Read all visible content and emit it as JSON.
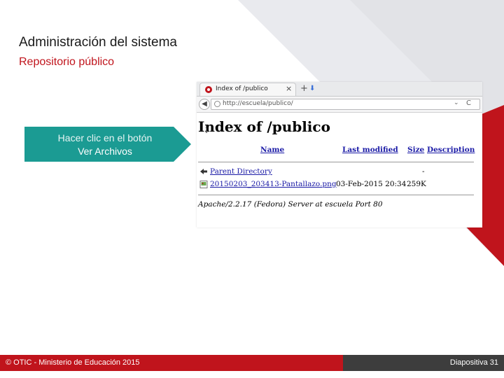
{
  "slide": {
    "title": "Administración del sistema",
    "subtitle": "Repositorio público"
  },
  "callout": {
    "line1": "Hacer clic en el botón",
    "line2": "Ver Archivos",
    "color": "#1b9b93"
  },
  "browser": {
    "tab_title": "Index of /publico",
    "tab_close": "×",
    "new_tab": "+",
    "download": "⬇",
    "back": "◀",
    "url": "http://escuela/publico/",
    "url_dropdown": "⌄",
    "reload": "C"
  },
  "listing": {
    "heading": "Index of /publico",
    "columns": [
      "Name",
      "Last modified",
      "Size",
      "Description"
    ],
    "rows": [
      {
        "icon": "back-arrow-icon",
        "name": "Parent Directory",
        "modified": "",
        "size": "-"
      },
      {
        "icon": "image-file-icon",
        "name": "20150203_203413-Pantallazo.png",
        "modified": "03-Feb-2015 20:34",
        "size": "259K"
      }
    ],
    "server": "Apache/2.2.17 (Fedora) Server at escuela Port 80"
  },
  "footer": {
    "copyright": "© OTIC - Ministerio de Educación 2015",
    "slide_number": "Diapositiva 31"
  },
  "colors": {
    "accent_red": "#c0141c",
    "teal": "#1b9b93",
    "dark": "#3d3d3d",
    "link": "#1a1aa6"
  }
}
